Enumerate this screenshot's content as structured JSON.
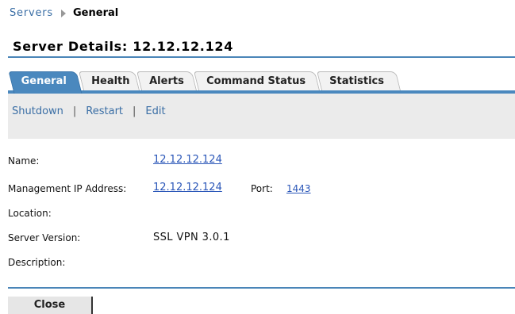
{
  "breadcrumb": {
    "parent": "Servers",
    "current": "General"
  },
  "page": {
    "title": "Server Details: 12.12.12.124"
  },
  "tabs": [
    {
      "label": "General",
      "active": true
    },
    {
      "label": "Health",
      "active": false
    },
    {
      "label": "Alerts",
      "active": false
    },
    {
      "label": "Command Status",
      "active": false
    },
    {
      "label": "Statistics",
      "active": false
    }
  ],
  "actions": {
    "shutdown": "Shutdown",
    "restart": "Restart",
    "edit": "Edit",
    "separator": "|"
  },
  "details": {
    "name": {
      "label": "Name:",
      "value": "12.12.12.124"
    },
    "management_ip": {
      "label": "Management IP Address:",
      "value": "12.12.12.124",
      "port_label": "Port:",
      "port_value": "1443"
    },
    "location": {
      "label": "Location:",
      "value": ""
    },
    "server_version": {
      "label": "Server Version:",
      "value": "SSL VPN 3.0.1"
    },
    "description": {
      "label": "Description:",
      "value": ""
    }
  },
  "footer": {
    "close_label": "Close"
  },
  "colors": {
    "accent": "#4a88be",
    "link": "#2a56b8",
    "action_bar": "#ebebeb"
  }
}
